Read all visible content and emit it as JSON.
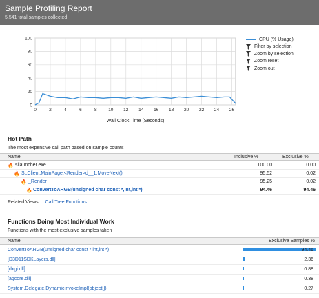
{
  "header": {
    "title": "Sample Profiling Report",
    "subtitle": "5,541 total samples collected"
  },
  "chart_data": {
    "type": "line",
    "xlabel": "Wall Clock Time (Seconds)",
    "ylabel": "",
    "xlim": [
      0,
      26.5
    ],
    "ylim": [
      0,
      100
    ],
    "xticks": [
      0,
      2,
      4,
      6,
      8,
      10,
      12,
      14,
      16,
      18,
      20,
      22,
      24,
      26
    ],
    "yticks": [
      0,
      20,
      40,
      60,
      80,
      100
    ],
    "grid": true,
    "legend": "right",
    "series": [
      {
        "name": "CPU (% Usage)",
        "color": "#3b8ed6",
        "x": [
          0,
          0.5,
          1,
          2,
          3,
          4,
          5,
          6,
          7,
          8,
          9,
          10,
          11,
          12,
          13,
          14,
          15,
          16,
          17,
          18,
          19,
          20,
          21,
          22,
          23,
          24,
          25,
          25.7,
          26.5
        ],
        "y": [
          0,
          3,
          17,
          13,
          11,
          11,
          9,
          12,
          11,
          11,
          10,
          11,
          11,
          10,
          12,
          10,
          11,
          12,
          11,
          10,
          12,
          11,
          12,
          13,
          12,
          11,
          12,
          12,
          2
        ]
      }
    ]
  },
  "legend_actions": [
    {
      "label": "CPU (% Usage)",
      "icon": "line-swatch"
    },
    {
      "label": "Filter by selection",
      "icon": "funnel-icon"
    },
    {
      "label": "Zoom by selection",
      "icon": "funnel-icon"
    },
    {
      "label": "Zoom reset",
      "icon": "funnel-icon"
    },
    {
      "label": "Zoom out",
      "icon": "funnel-icon"
    }
  ],
  "hot_path": {
    "title": "Hot Path",
    "description": "The most expensive call path based on sample counts",
    "columns": {
      "name": "Name",
      "inclusive": "Inclusive %",
      "exclusive": "Exclusive %"
    },
    "rows": [
      {
        "name": "sllauncher.exe",
        "inclusive": "100.00",
        "exclusive": "0.00"
      },
      {
        "name": "SLClient.MainPage.<Render>d__1.MoveNext()",
        "inclusive": "95.52",
        "exclusive": "0.02"
      },
      {
        "name": "_Render",
        "inclusive": "95.25",
        "exclusive": "0.02"
      },
      {
        "name": "ConvertToARGB(unsigned char const *,int,int *)",
        "inclusive": "94.46",
        "exclusive": "94.46"
      }
    ],
    "related_views_label": "Related Views:",
    "related_views_link": "Call Tree  Functions"
  },
  "functions": {
    "title": "Functions Doing Most Individual Work",
    "description": "Functions with the most exclusive samples taken",
    "columns": {
      "name": "Name",
      "exclusive": "Exclusive Samples %"
    },
    "rows": [
      {
        "name": "ConvertToARGB(unsigned char const *,int,int *)",
        "value": "94.46",
        "pct": 94.46
      },
      {
        "name": "[D3D11SDKLayers.dll]",
        "value": "2.36",
        "pct": 2.36
      },
      {
        "name": "[dxgi.dll]",
        "value": "0.88",
        "pct": 0.88
      },
      {
        "name": "[agcore.dll]",
        "value": "0.38",
        "pct": 0.38
      },
      {
        "name": "System.Delegate.DynamicInvokeImpl(object[])",
        "value": "0.27",
        "pct": 0.27
      }
    ]
  }
}
